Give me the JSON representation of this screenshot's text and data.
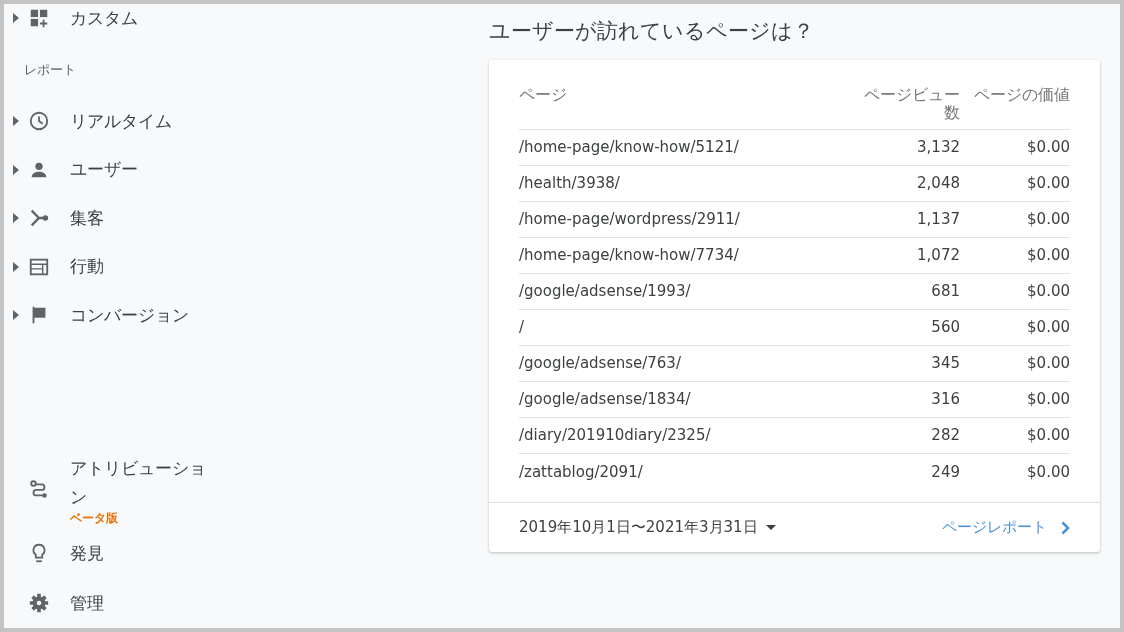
{
  "sidebar": {
    "top_item": {
      "label": "カスタム",
      "expandable": true
    },
    "section_label": "レポート",
    "report_items": [
      {
        "label": "リアルタイム",
        "expandable": true
      },
      {
        "label": "ユーザー",
        "expandable": true
      },
      {
        "label": "集客",
        "expandable": true
      },
      {
        "label": "行動",
        "expandable": true
      },
      {
        "label": "コンバージョン",
        "expandable": true
      }
    ],
    "bottom_items": [
      {
        "label": "アトリビューション",
        "badge": "ベータ版",
        "expandable": false
      },
      {
        "label": "発見",
        "expandable": false
      },
      {
        "label": "管理",
        "expandable": false
      }
    ]
  },
  "main": {
    "heading": "ユーザーが訪れているページは？",
    "table": {
      "columns": [
        "ページ",
        "ページビュー数",
        "ページの価値"
      ],
      "rows": [
        [
          "/home-page/know-how/5121/",
          "3,132",
          "$0.00"
        ],
        [
          "/health/3938/",
          "2,048",
          "$0.00"
        ],
        [
          "/home-page/wordpress/2911/",
          "1,137",
          "$0.00"
        ],
        [
          "/home-page/know-how/7734/",
          "1,072",
          "$0.00"
        ],
        [
          "/google/adsense/1993/",
          "681",
          "$0.00"
        ],
        [
          "/",
          "560",
          "$0.00"
        ],
        [
          "/google/adsense/763/",
          "345",
          "$0.00"
        ],
        [
          "/google/adsense/1834/",
          "316",
          "$0.00"
        ],
        [
          "/diary/201910diary/2325/",
          "282",
          "$0.00"
        ],
        [
          "/zattablog/2091/",
          "249",
          "$0.00"
        ]
      ]
    },
    "date_range": "2019年10月1日〜2021年3月31日",
    "report_link": "ページレポート"
  }
}
